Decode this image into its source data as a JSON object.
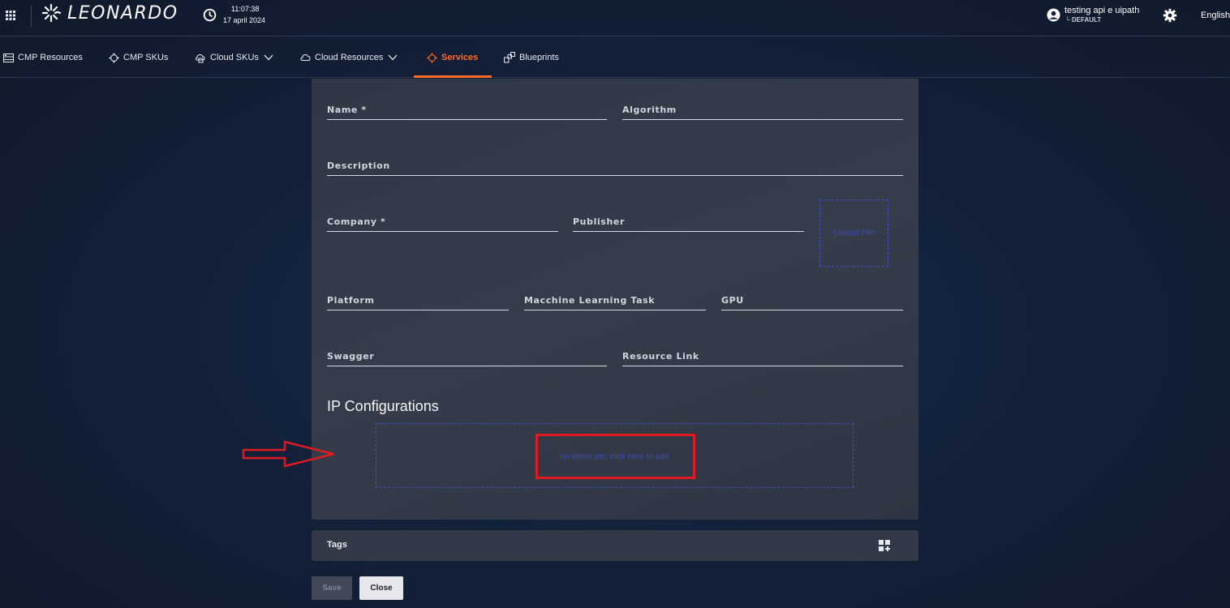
{
  "header": {
    "brand": "LEONARDO",
    "time": "11:07:38",
    "date": "17 april 2024",
    "user_name": "testing api e uipath",
    "user_tenant": "└ DEFAULT",
    "language": "English"
  },
  "nav": {
    "items": [
      {
        "label": "CMP Resources",
        "icon": "server-icon"
      },
      {
        "label": "CMP SKUs",
        "icon": "gear-icon"
      },
      {
        "label": "Cloud SKUs",
        "icon": "cloud-box-icon",
        "dropdown": true
      },
      {
        "label": "Cloud Resources",
        "icon": "cloud-icon",
        "dropdown": true
      },
      {
        "label": "Services",
        "icon": "gear-icon",
        "active": true
      },
      {
        "label": "Blueprints",
        "icon": "blueprint-icon"
      }
    ]
  },
  "form": {
    "name_label": "Name *",
    "algorithm_label": "Algorithm",
    "description_label": "Description",
    "company_label": "Company *",
    "publisher_label": "Publisher",
    "upload_label": "Upload File",
    "platform_label": "Platform",
    "ml_task_label": "Macchine Learning Task",
    "gpu_label": "GPU",
    "swagger_label": "Swagger",
    "resource_link_label": "Resource Link"
  },
  "ip_config": {
    "title": "IP Configurations",
    "empty_text": "No items yet, click here to add."
  },
  "tags": {
    "label": "Tags"
  },
  "actions": {
    "save_label": "Save",
    "close_label": "Close"
  },
  "colors": {
    "accent": "#ff6a2c",
    "link": "#3d48b8",
    "highlight": "#e01a22"
  }
}
